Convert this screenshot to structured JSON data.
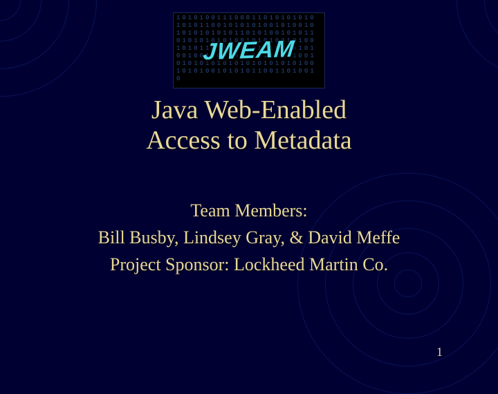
{
  "logo": {
    "text": "JWEAM",
    "binary_bg": "1010100111000110101010101010110010101010010100101010101010110101001010110101010101001010100101001010110110011010101001010010011001010101101010010101010101010101010101001010100101010110011010010"
  },
  "title": {
    "line1": "Java Web-Enabled",
    "line2": "Access to Metadata"
  },
  "team": {
    "heading": "Team Members:",
    "members": "Bill Busby, Lindsey Gray, & David Meffe",
    "sponsor": "Project Sponsor:  Lockheed Martin Co."
  },
  "slide_number": "1"
}
